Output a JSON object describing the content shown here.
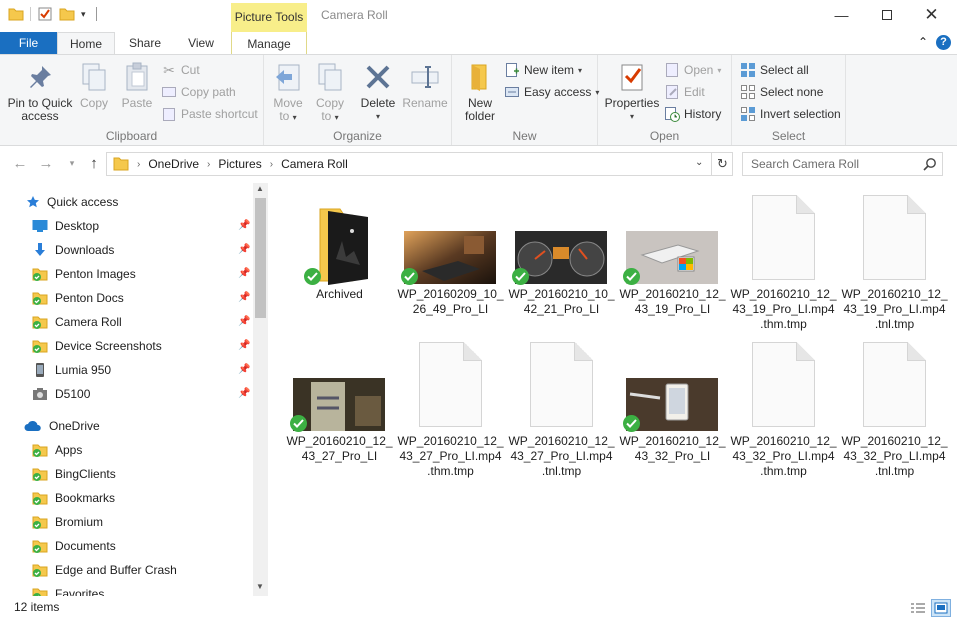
{
  "title": "Camera Roll",
  "context_tab": "Picture Tools",
  "tabs": {
    "file": "File",
    "home": "Home",
    "share": "Share",
    "view": "View",
    "manage": "Manage"
  },
  "ribbon": {
    "clipboard": {
      "label": "Clipboard",
      "pin": "Pin to Quick access",
      "pin_l1": "Pin to Quick",
      "pin_l2": "access",
      "copy": "Copy",
      "paste": "Paste",
      "cut": "Cut",
      "copy_path": "Copy path",
      "paste_shortcut": "Paste shortcut"
    },
    "organize": {
      "label": "Organize",
      "move_to": "Move",
      "move_to_2": "to",
      "copy_to": "Copy",
      "copy_to_2": "to",
      "delete": "Delete",
      "rename": "Rename"
    },
    "new": {
      "label": "New",
      "new_folder": "New",
      "new_folder_2": "folder",
      "new_item": "New item",
      "easy_access": "Easy access"
    },
    "open": {
      "label": "Open",
      "properties": "Properties",
      "open": "Open",
      "edit": "Edit",
      "history": "History"
    },
    "select": {
      "label": "Select",
      "select_all": "Select all",
      "select_none": "Select none",
      "invert": "Invert selection"
    }
  },
  "address": {
    "crumbs": [
      "OneDrive",
      "Pictures",
      "Camera Roll"
    ],
    "search_placeholder": "Search Camera Roll"
  },
  "navpane": {
    "quick_access": "Quick access",
    "quick_items": [
      {
        "label": "Desktop",
        "icon": "desktop-icon"
      },
      {
        "label": "Downloads",
        "icon": "downloads-icon"
      },
      {
        "label": "Penton Images",
        "icon": "folder-icon"
      },
      {
        "label": "Penton Docs",
        "icon": "folder-icon"
      },
      {
        "label": "Camera Roll",
        "icon": "folder-icon"
      },
      {
        "label": "Device Screenshots",
        "icon": "folder-icon"
      },
      {
        "label": "Lumia 950",
        "icon": "phone-icon"
      },
      {
        "label": "D5100",
        "icon": "camera-icon"
      }
    ],
    "onedrive": "OneDrive",
    "onedrive_items": [
      "Apps",
      "BingClients",
      "Bookmarks",
      "Bromium",
      "Documents",
      "Edge and Buffer Crash",
      "Favorites"
    ]
  },
  "files": [
    {
      "l1": "Archived",
      "l2": "",
      "l3": "",
      "kind": "folder"
    },
    {
      "l1": "WP_20160209_10_",
      "l2": "26_49_Pro_LI",
      "l3": "",
      "kind": "photo-laptop"
    },
    {
      "l1": "WP_20160210_10_",
      "l2": "42_21_Pro_LI",
      "l3": "",
      "kind": "photo-gauges"
    },
    {
      "l1": "WP_20160210_12_",
      "l2": "43_19_Pro_LI",
      "l3": "",
      "kind": "photo-drone"
    },
    {
      "l1": "WP_20160210_12_",
      "l2": "43_19_Pro_LI.mp4",
      "l3": ".thm.tmp",
      "kind": "doc"
    },
    {
      "l1": "WP_20160210_12_",
      "l2": "43_19_Pro_LI.mp4",
      "l3": ".tnl.tmp",
      "kind": "doc"
    },
    {
      "l1": "WP_20160210_12_",
      "l2": "43_27_Pro_LI",
      "l3": "",
      "kind": "photo-can"
    },
    {
      "l1": "WP_20160210_12_",
      "l2": "43_27_Pro_LI.mp4",
      "l3": ".thm.tmp",
      "kind": "doc"
    },
    {
      "l1": "WP_20160210_12_",
      "l2": "43_27_Pro_LI.mp4",
      "l3": ".tnl.tmp",
      "kind": "doc"
    },
    {
      "l1": "WP_20160210_12_",
      "l2": "43_32_Pro_LI",
      "l3": "",
      "kind": "photo-phone"
    },
    {
      "l1": "WP_20160210_12_",
      "l2": "43_32_Pro_LI.mp4",
      "l3": ".thm.tmp",
      "kind": "doc"
    },
    {
      "l1": "WP_20160210_12_",
      "l2": "43_32_Pro_LI.mp4",
      "l3": ".tnl.tmp",
      "kind": "doc"
    }
  ],
  "status": {
    "count": "12 items"
  },
  "colors": {
    "accent": "#1a6fc1",
    "context_tab": "#f8ee8a",
    "sync_check": "#3cb043",
    "folder": "#f5c84c"
  }
}
